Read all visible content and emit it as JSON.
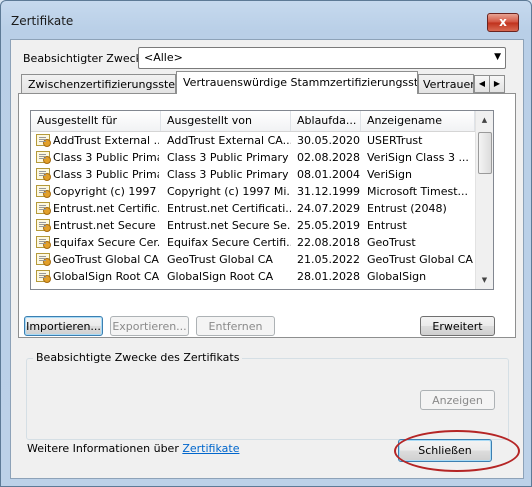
{
  "window": {
    "title": "Zertifikate",
    "close_glyph": "x"
  },
  "purpose": {
    "label": "Beabsichtigter Zweck:",
    "value": "<Alle>"
  },
  "tabs": [
    {
      "label": "Zwischenzertifizierungsstellen"
    },
    {
      "label": "Vertrauenswürdige Stammzertifizierungsstellen"
    },
    {
      "label": "Vertrauens"
    }
  ],
  "list": {
    "columns": [
      "Ausgestellt für",
      "Ausgestellt von",
      "Ablaufda...",
      "Anzeigename"
    ],
    "rows": [
      [
        "AddTrust External ...",
        "AddTrust External CA...",
        "30.05.2020",
        "USERTrust"
      ],
      [
        "Class 3 Public Prima...",
        "Class 3 Public Primary ...",
        "02.08.2028",
        "VeriSign Class 3 ..."
      ],
      [
        "Class 3 Public Prima...",
        "Class 3 Public Primary ...",
        "08.01.2004",
        "VeriSign"
      ],
      [
        "Copyright (c) 1997 ...",
        "Copyright (c) 1997 Mi...",
        "31.12.1999",
        "Microsoft Timest..."
      ],
      [
        "Entrust.net Certific...",
        "Entrust.net Certificati...",
        "24.07.2029",
        "Entrust (2048)"
      ],
      [
        "Entrust.net Secure ...",
        "Entrust.net Secure Se...",
        "25.05.2019",
        "Entrust"
      ],
      [
        "Equifax Secure Cer...",
        "Equifax Secure Certifi...",
        "22.08.2018",
        "GeoTrust"
      ],
      [
        "GeoTrust Global CA",
        "GeoTrust Global CA",
        "21.05.2022",
        "GeoTrust Global CA"
      ],
      [
        "GlobalSign Root CA",
        "GlobalSign Root CA",
        "28.01.2028",
        "GlobalSign"
      ]
    ]
  },
  "buttons": {
    "import": "Importieren...",
    "export": "Exportieren...",
    "remove": "Entfernen",
    "advanced": "Erweitert",
    "view": "Anzeigen",
    "close": "Schließen"
  },
  "purposes_group": {
    "label": "Beabsichtigte Zwecke des Zertifikats"
  },
  "more_info": {
    "prefix": "Weitere Informationen über ",
    "link": "Zertifikate"
  },
  "colors": {
    "highlight": "#b52525",
    "link": "#0066cc"
  }
}
